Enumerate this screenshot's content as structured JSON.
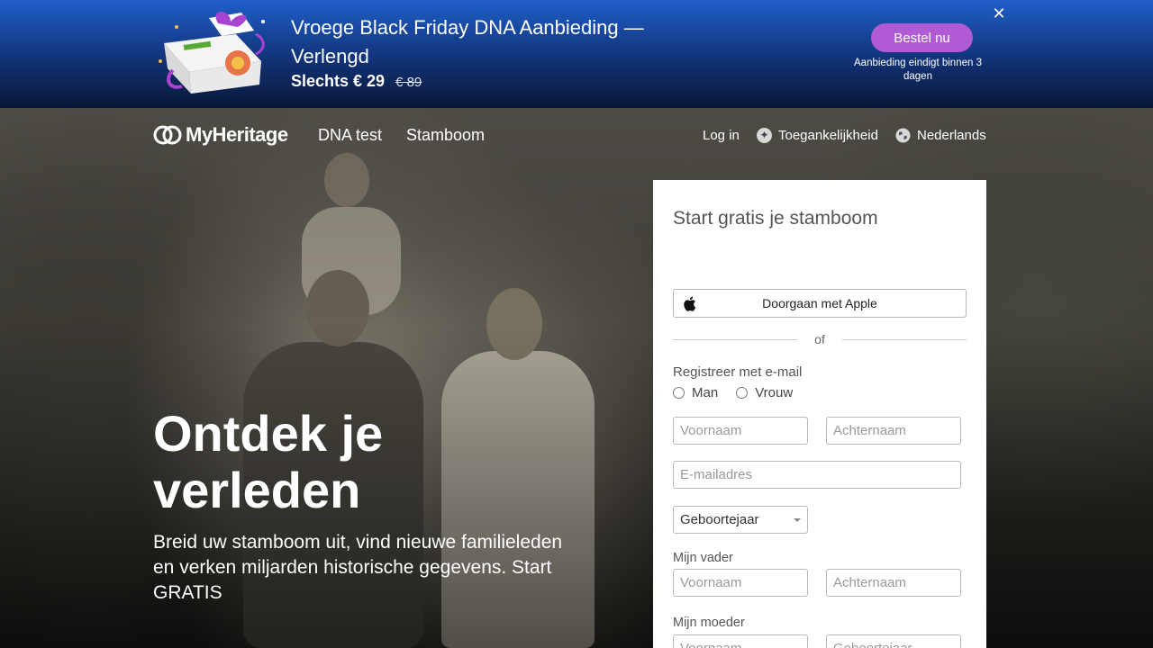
{
  "banner": {
    "title": "Vroege Black Friday DNA Aanbieding — Verlengd",
    "price_now": "Slechts € 29",
    "price_was": "€ 89",
    "order_label": "Bestel nu",
    "ends_text": "Aanbieding eindigt binnen 3 dagen",
    "close_glyph": "✕",
    "button_color": "#b05ad6"
  },
  "nav": {
    "logo_text": "MyHeritage",
    "links": [
      "DNA test",
      "Stamboom"
    ],
    "login": "Log in",
    "accessibility": "Toegankelijkheid",
    "language": "Nederlands"
  },
  "hero": {
    "headline": "Ontdek je verleden",
    "subline": "Breid uw stamboom uit, vind nieuwe familieleden en verken miljarden historische gegevens. Start GRATIS"
  },
  "form": {
    "title": "Start gratis je stamboom",
    "apple_label": "Doorgaan met Apple",
    "or_text": "of",
    "email_section": "Registreer met e-mail",
    "gender_options": [
      "Man",
      "Vrouw"
    ],
    "first_name_placeholder": "Voornaam",
    "last_name_placeholder": "Achternaam",
    "email_placeholder": "E-mailadres",
    "birth_year_value": "Geboortejaar",
    "father_label": "Mijn vader",
    "father_first_placeholder": "Voornaam",
    "father_last_placeholder": "Achternaam",
    "mother_label": "Mijn moeder",
    "mother_first_placeholder": "Voornaam",
    "mother_year_placeholder": "Geboortejaar"
  }
}
